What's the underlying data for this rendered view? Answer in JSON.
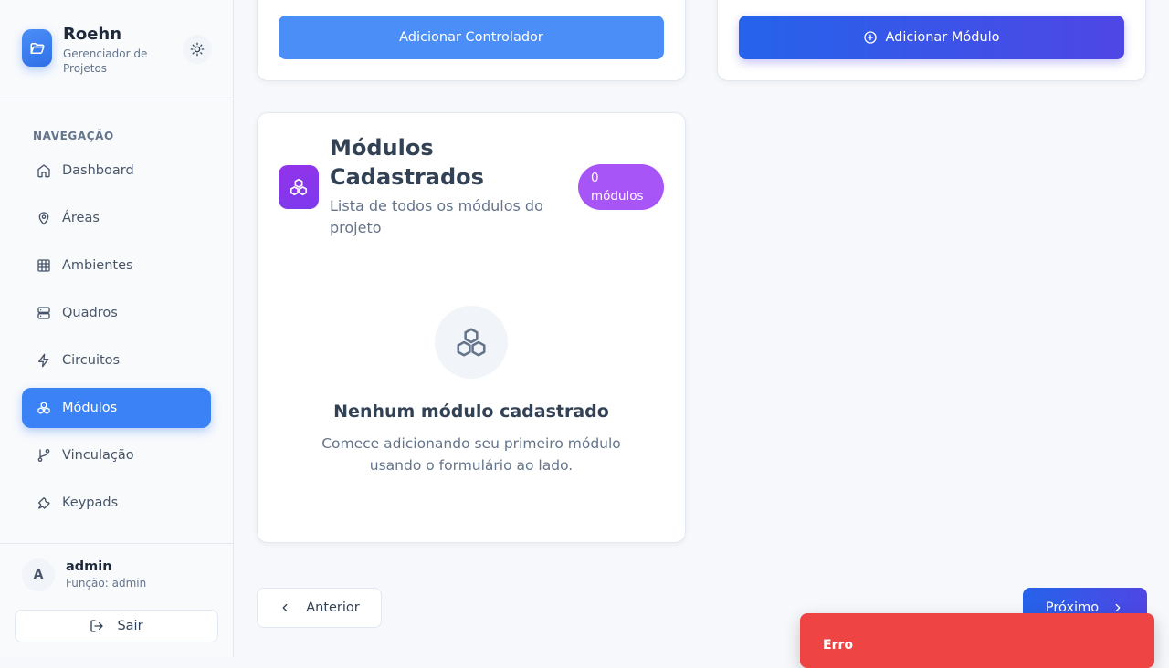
{
  "brand": {
    "name": "Roehn",
    "subtitle": "Gerenciador de Projetos"
  },
  "nav": {
    "heading": "NAVEGAÇÃO",
    "items": [
      {
        "label": "Dashboard",
        "icon": "home-icon"
      },
      {
        "label": "Áreas",
        "icon": "map-pin-icon"
      },
      {
        "label": "Ambientes",
        "icon": "grid-icon"
      },
      {
        "label": "Quadros",
        "icon": "server-icon"
      },
      {
        "label": "Circuitos",
        "icon": "zap-icon"
      },
      {
        "label": "Módulos",
        "icon": "boxes-icon",
        "active": true
      },
      {
        "label": "Vinculação",
        "icon": "git-branch-icon"
      },
      {
        "label": "Keypads",
        "icon": "wrench-icon"
      }
    ]
  },
  "user": {
    "initial": "A",
    "name": "admin",
    "role": "Função: admin",
    "logout_label": "Sair"
  },
  "forms": {
    "add_controller_label": "Adicionar Controlador",
    "add_module_label": "Adicionar Módulo"
  },
  "modules_card": {
    "title": "Módulos Cadastrados",
    "subtitle": "Lista de todos os módulos do projeto",
    "badge": "0 módulos",
    "empty_title": "Nenhum módulo cadastrado",
    "empty_text": "Comece adicionando seu primeiro módulo usando o formulário ao lado."
  },
  "pagination": {
    "prev_label": "Anterior",
    "next_label": "Próximo"
  },
  "toast": {
    "title": "Erro"
  },
  "colors": {
    "primary": "#3b82f6",
    "gradient_start": "#2563eb",
    "gradient_end": "#4f46e5",
    "purple": "#a855f7",
    "error": "#ef4444"
  }
}
